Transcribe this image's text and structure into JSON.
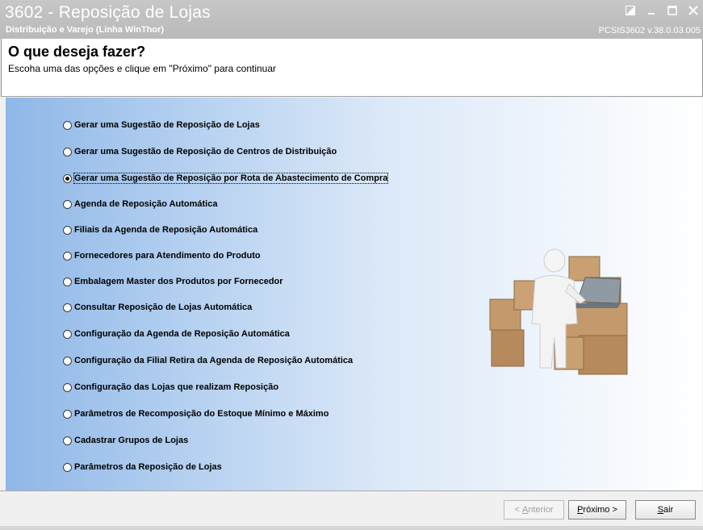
{
  "titlebar": {
    "title": "3602 - Reposição de Lojas",
    "subtitle": "Distribuição e Varejo (Linha WinThor)",
    "version": "PCSIS3602  v.38.0.03.005"
  },
  "header": {
    "heading": "O que deseja fazer?",
    "instruction": "Escoha uma das opções e clique em \"Próximo\" para continuar"
  },
  "options": [
    {
      "label": "Gerar uma Sugestão de Reposição de Lojas",
      "selected": false
    },
    {
      "label": "Gerar uma Sugestão de Reposição de Centros de Distribuição",
      "selected": false
    },
    {
      "label": "Gerar uma Sugestão de Reposição por Rota de Abastecimento de Compra",
      "selected": true
    },
    {
      "label": "Agenda de Reposição Automática",
      "selected": false
    },
    {
      "label": "Filiais da Agenda de Reposição Automática",
      "selected": false
    },
    {
      "label": "Fornecedores para Atendimento do Produto",
      "selected": false
    },
    {
      "label": "Embalagem Master dos Produtos por Fornecedor",
      "selected": false
    },
    {
      "label": "Consultar Reposição de Lojas Automática",
      "selected": false
    },
    {
      "label": "Configuração da Agenda de Reposição Automática",
      "selected": false
    },
    {
      "label": "Configuração da Filial Retira da Agenda de Reposição Automática",
      "selected": false
    },
    {
      "label": "Configuração das Lojas que realizam Reposição",
      "selected": false
    },
    {
      "label": "Parâmetros de Recomposição do Estoque Mínimo e Máximo",
      "selected": false
    },
    {
      "label": "Cadastrar Grupos de Lojas",
      "selected": false
    },
    {
      "label": "Parâmetros da Reposição de Lojas",
      "selected": false
    }
  ],
  "buttons": {
    "back_prefix": "< ",
    "back_key": "A",
    "back_rest": "nterior",
    "next_key": "P",
    "next_rest": "róximo >",
    "exit_key": "S",
    "exit_rest": "air"
  },
  "icons": {
    "edit": "edit-window-icon",
    "minimize": "minimize-icon",
    "maximize": "maximize-icon",
    "close": "close-icon"
  }
}
